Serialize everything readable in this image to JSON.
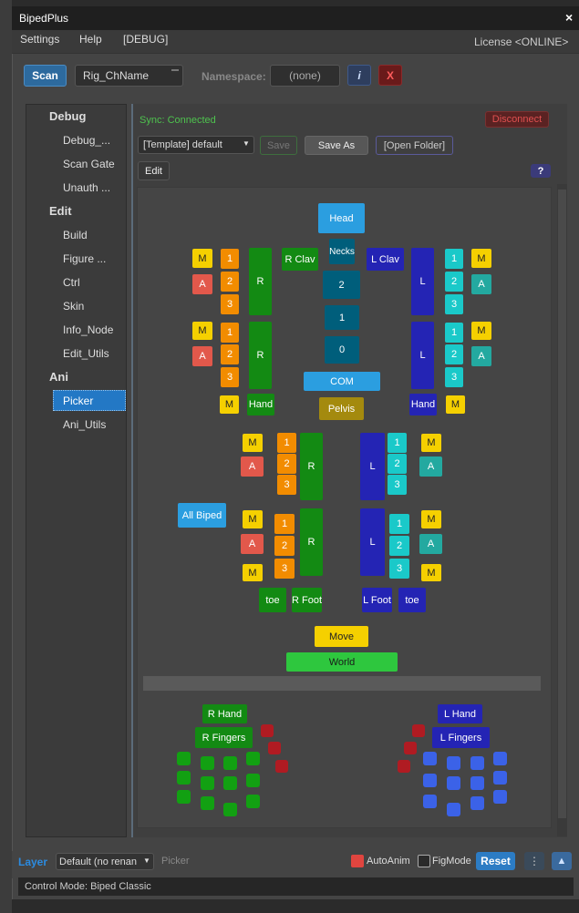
{
  "window": {
    "title": "BipedPlus",
    "close_icon": "×"
  },
  "menu": {
    "items": [
      "Settings",
      "Help",
      "[DEBUG]"
    ],
    "license": "License <ONLINE>"
  },
  "toolbar": {
    "scan": "Scan",
    "rig_name": "Rig_ChName",
    "namespace_label": "Namespace:",
    "namespace_value": "(none)",
    "info": "i",
    "clear": "X"
  },
  "sidebar": {
    "debug": "Debug",
    "debug_items": [
      "Debug_...",
      "Scan Gate",
      "Unauth ..."
    ],
    "edit": "Edit",
    "edit_items": [
      "Build",
      "Figure ...",
      "Ctrl",
      "Skin",
      "Info_Node",
      "Edit_Utils"
    ],
    "ani": "Ani",
    "ani_items": [
      "Picker",
      "Ani_Utils"
    ]
  },
  "panel": {
    "sync": "Sync: Connected",
    "disconnect": "Disconnect",
    "template": "[Template] default",
    "save": "Save",
    "save_as": "Save As",
    "open_folder": "[Open Folder]",
    "edit": "Edit",
    "help": "?"
  },
  "picker": {
    "head": "Head",
    "necks": "Necks",
    "spine2": "2",
    "spine1": "1",
    "spine0": "0",
    "com": "COM",
    "pelvis": "Pelvis",
    "r_clav": "R Clav",
    "l_clav": "L Clav",
    "m": "M",
    "a": "A",
    "n1": "1",
    "n2": "2",
    "n3": "3",
    "r": "R",
    "l": "L",
    "hand": "Hand",
    "all_biped": "All Biped",
    "toe": "toe",
    "r_foot": "R Foot",
    "l_foot": "L Foot",
    "move": "Move",
    "world": "World",
    "r_hand": "R Hand",
    "l_hand": "L Hand",
    "r_fingers": "R Fingers",
    "l_fingers": "L Fingers"
  },
  "footer": {
    "layer": "Layer",
    "layer_value": "Default (no renan",
    "picker": "Picker",
    "autoanim": "AutoAnim",
    "figmode": "FigMode",
    "reset": "Reset",
    "more": "⋮",
    "up": "▲"
  },
  "status": "Control Mode: Biped Classic",
  "colors": {
    "accent": "#2378c5",
    "sync": "#4ec24e",
    "disconnect": "#e05050"
  }
}
